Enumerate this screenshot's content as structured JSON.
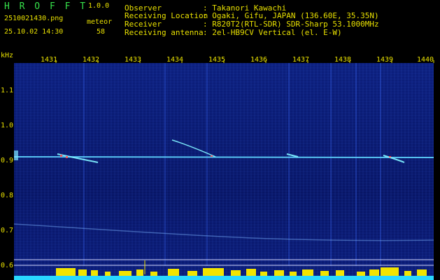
{
  "header": {
    "app_name": "H R O F F T",
    "version": "1.0.0",
    "file_name": "2510021430.png",
    "datetime": "25.10.02 14:30",
    "count_label": "meteor",
    "count_value": "58",
    "info": [
      {
        "label": "Observer",
        "value": ": Takanori Kawachi"
      },
      {
        "label": "Receiving Location",
        "value": ": Ogaki, Gifu, JAPAN (136.60E, 35.35N)"
      },
      {
        "label": "Receiver",
        "value": ": R820T2(RTL-SDR) SDR-Sharp 53.1000MHz"
      },
      {
        "label": "Receiving antenna",
        "value": ": 2el-HB9CV Vertical (el. E-W)"
      }
    ]
  },
  "axes": {
    "y_unit": "kHz",
    "x_ticks": [
      "1431",
      "1432",
      "1433",
      "1434",
      "1435",
      "1436",
      "1437",
      "1438",
      "1439",
      "1440"
    ],
    "y_ticks": [
      "1.1",
      "1.0",
      "0.9",
      "0.8",
      "0.7",
      "0.6"
    ]
  },
  "colors": {
    "text_yellow": "#e8e000",
    "logo_green": "#36e04a",
    "background": "#000000",
    "spectrogram_blue": "#0a1660",
    "carrier_line": "#5fd6ff",
    "activity_bars": "#f2e400",
    "baseline_cyan": "#29d7ff"
  }
}
